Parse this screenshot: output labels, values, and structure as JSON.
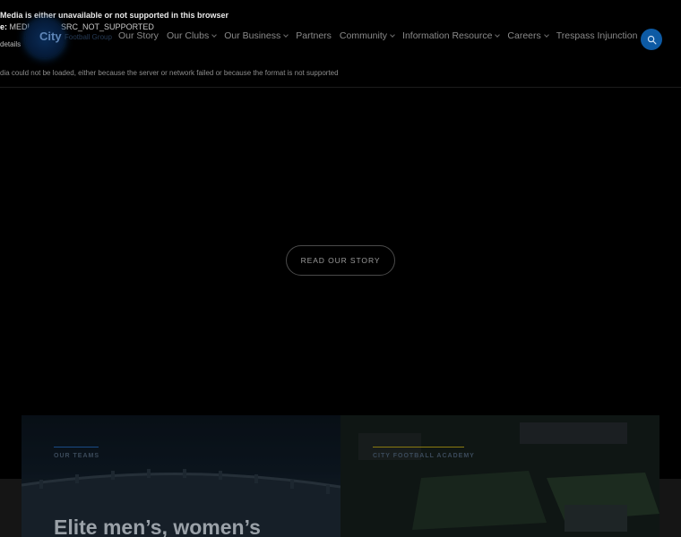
{
  "video_error": {
    "title": "Media is either unavailable or not supported in this browser",
    "code_label": "e:",
    "code_value": "MEDIA_ERR_SRC_NOT_SUPPORTED",
    "details_label": "details",
    "message": "dia could not be loaded, either because the server or network failed or because the format is not supported",
    "tiny_left": "",
    "tiny_right": ""
  },
  "header": {
    "logo_text": "City",
    "logo_sub": "Football Group",
    "nav": [
      {
        "label": "Our Story",
        "has_menu": false
      },
      {
        "label": "Our Clubs",
        "has_menu": true
      },
      {
        "label": "Our Business",
        "has_menu": true
      },
      {
        "label": "Partners",
        "has_menu": false
      },
      {
        "label": "Community",
        "has_menu": true
      },
      {
        "label": "Information Resource",
        "has_menu": true
      },
      {
        "label": "Careers",
        "has_menu": true
      },
      {
        "label": "Trespass Injunction",
        "has_menu": false
      }
    ],
    "search_icon": "search-icon"
  },
  "hero": {
    "cta_label": "READ OUR STORY"
  },
  "cards": [
    {
      "label": "OUR TEAMS",
      "title": "Elite men’s, women’s",
      "accent": "#1a4a86"
    },
    {
      "label": "CITY FOOTBALL ACADEMY",
      "title": "",
      "accent": "#8a7a10"
    }
  ],
  "colors": {
    "brand_blue": "#0d5aa4",
    "background": "#000000"
  }
}
